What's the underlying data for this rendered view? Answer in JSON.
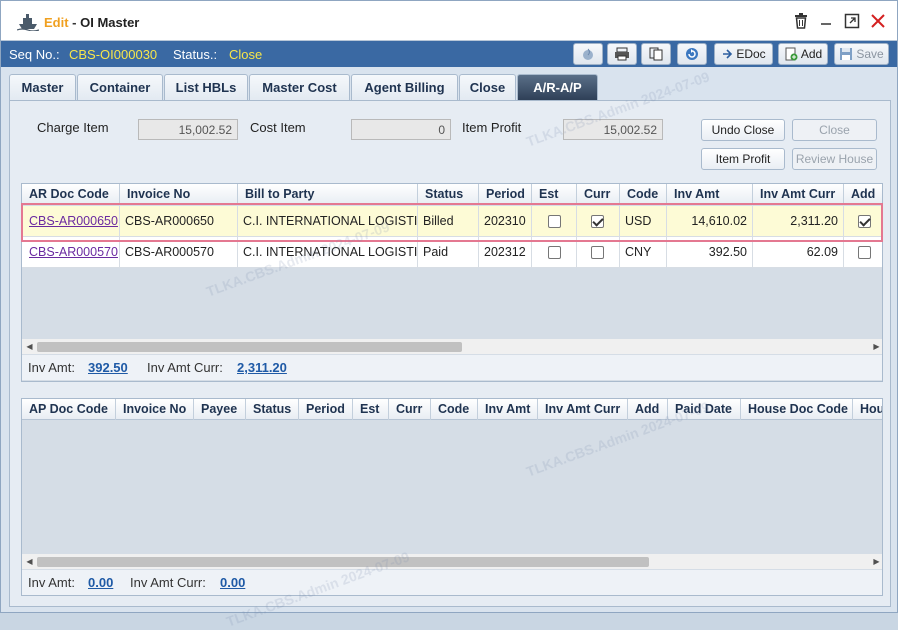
{
  "window": {
    "edit_label": "Edit",
    "separator": " - ",
    "title": "OI Master"
  },
  "info": {
    "seq_label": "Seq No.:",
    "seq_value": "CBS-OI000030",
    "status_label": "Status.:",
    "status_value": "Close"
  },
  "toolbar": {
    "edoc_label": "EDoc",
    "add_label": "Add",
    "save_label": "Save"
  },
  "tabs": [
    {
      "label": "Master"
    },
    {
      "label": "Container"
    },
    {
      "label": "List HBLs"
    },
    {
      "label": "Master Cost"
    },
    {
      "label": "Agent Billing"
    },
    {
      "label": "Close"
    },
    {
      "label": "A/R-A/P"
    }
  ],
  "summary": {
    "charge_item_label": "Charge Item",
    "charge_item_value": "15,002.52",
    "cost_item_label": "Cost Item",
    "cost_item_value": "0",
    "item_profit_label": "Item Profit",
    "item_profit_value": "15,002.52"
  },
  "actions": {
    "undo_close": "Undo Close",
    "close": "Close",
    "item_profit": "Item Profit",
    "review_house": "Review House"
  },
  "ar_grid": {
    "headers": [
      "AR Doc Code",
      "Invoice No",
      "Bill to Party",
      "Status",
      "Period",
      "Est",
      "Curr",
      "Code",
      "Inv Amt",
      "Inv Amt Curr",
      "Add"
    ],
    "rows": [
      {
        "doc": "CBS-AR000650",
        "invoice": "CBS-AR000650",
        "party": "C.I. INTERNATIONAL LOGISTICS",
        "status": "Billed",
        "period": "202310",
        "est": false,
        "curr": true,
        "code": "USD",
        "inv_amt": "14,610.02",
        "inv_amt_curr": "2,311.20",
        "add": true
      },
      {
        "doc": "CBS-AR000570",
        "invoice": "CBS-AR000570",
        "party": "C.I. INTERNATIONAL LOGISTICS",
        "status": "Paid",
        "period": "202312",
        "est": false,
        "curr": false,
        "code": "CNY",
        "inv_amt": "392.50",
        "inv_amt_curr": "62.09",
        "add": false
      }
    ],
    "footer": {
      "inv_amt_label": "Inv Amt:",
      "inv_amt_value": "392.50",
      "inv_amt_curr_label": "Inv Amt Curr:",
      "inv_amt_curr_value": "2,311.20"
    }
  },
  "ap_grid": {
    "headers": [
      "AP Doc Code",
      "Invoice No",
      "Payee",
      "Status",
      "Period",
      "Est",
      "Curr",
      "Code",
      "Inv Amt",
      "Inv Amt Curr",
      "Add",
      "Paid Date",
      "House Doc Code",
      "Hou"
    ],
    "footer": {
      "inv_amt_label": "Inv Amt:",
      "inv_amt_value": "0.00",
      "inv_amt_curr_label": "Inv Amt Curr:",
      "inv_amt_curr_value": "0.00"
    }
  },
  "watermark": "TLKA.CBS.Admin 2024-07-09",
  "colors": {
    "info_bar": "#3a69a3",
    "status_value": "#f7e64a",
    "edit_label": "#f0a020",
    "selected_row": "#fdfbd6",
    "selection_border": "#e47891"
  }
}
